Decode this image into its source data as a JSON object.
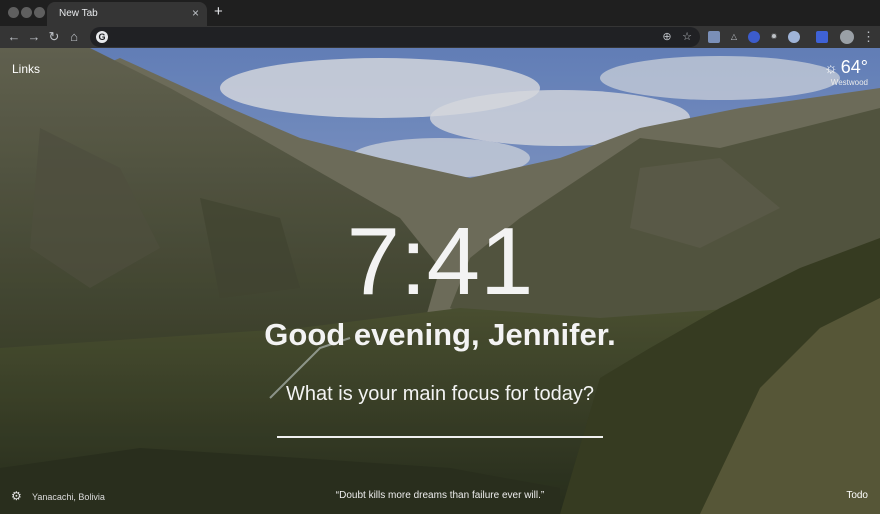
{
  "browser": {
    "tab_title": "New Tab",
    "tab_close": "×",
    "new_tab": "+",
    "omnibox_value": "",
    "omnibox_icon": "G",
    "nav_icons": [
      "back-arrow-icon",
      "forward-arrow-icon",
      "reload-icon",
      "home-icon"
    ],
    "extension_icons": [
      "extension-1-icon",
      "extension-2-icon",
      "extension-3-icon",
      "extension-4-icon",
      "extension-5-icon",
      "extension-6-icon"
    ]
  },
  "dashboard": {
    "links_label": "Links",
    "weather_temp": "64°",
    "weather_location": "Westwood",
    "clock": "7:41",
    "greeting": "Good evening, Jennifer.",
    "focus_question": "What is your main focus for today?",
    "focus_value": "",
    "photo_location": "Yanacachi, Bolivia",
    "quote": "“Doubt kills more dreams than failure ever will.”",
    "todo_label": "Todo"
  },
  "colors": {
    "chrome_dark": "#1f1f1f",
    "toolbar": "#353535",
    "text_white": "#f3f3f3",
    "sky": "#8aa6d8",
    "mountain": "#4e5536"
  }
}
